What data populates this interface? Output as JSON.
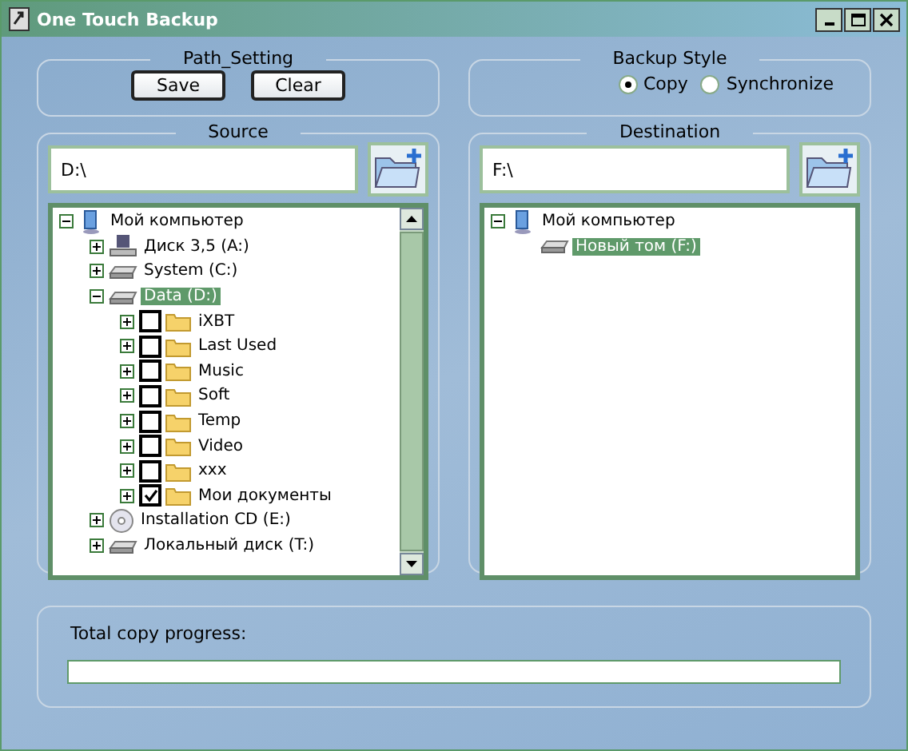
{
  "window": {
    "title": "One Touch Backup"
  },
  "path_setting": {
    "title": "Path_Setting",
    "buttons": [
      "Save",
      "Clear"
    ]
  },
  "backup_style": {
    "title": "Backup Style",
    "options": [
      {
        "label": "Copy",
        "selected": true
      },
      {
        "label": "Synchronize",
        "selected": false
      }
    ]
  },
  "source": {
    "title": "Source",
    "path": "D:\\",
    "tree": [
      {
        "kind": "computer",
        "label": "Мой компьютер",
        "expanded": true,
        "selected": false,
        "children": [
          {
            "kind": "floppy",
            "label": "Диск 3,5 (A:)",
            "expanded": false,
            "selected": false
          },
          {
            "kind": "drive",
            "label": "System (C:)",
            "expanded": false,
            "selected": false
          },
          {
            "kind": "drive",
            "label": "Data (D:)",
            "expanded": true,
            "selected": true,
            "children": [
              {
                "kind": "folder",
                "label": "iXBT",
                "expanded": false,
                "selected": false,
                "checked": false
              },
              {
                "kind": "folder",
                "label": "Last Used",
                "expanded": false,
                "selected": false,
                "checked": false
              },
              {
                "kind": "folder",
                "label": "Music",
                "expanded": false,
                "selected": false,
                "checked": false
              },
              {
                "kind": "folder",
                "label": "Soft",
                "expanded": false,
                "selected": false,
                "checked": false
              },
              {
                "kind": "folder",
                "label": "Temp",
                "expanded": false,
                "selected": false,
                "checked": false
              },
              {
                "kind": "folder",
                "label": "Video",
                "expanded": false,
                "selected": false,
                "checked": false
              },
              {
                "kind": "folder",
                "label": "xxx",
                "expanded": false,
                "selected": false,
                "checked": false
              },
              {
                "kind": "folder",
                "label": "Мои документы",
                "expanded": false,
                "selected": false,
                "checked": true
              }
            ]
          },
          {
            "kind": "cd",
            "label": "Installation CD (E:)",
            "expanded": false,
            "selected": false
          },
          {
            "kind": "drive",
            "label": "Локальный диск (T:)",
            "expanded": false,
            "selected": false
          }
        ]
      }
    ]
  },
  "destination": {
    "title": "Destination",
    "path": "F:\\",
    "tree": [
      {
        "kind": "computer",
        "label": "Мой компьютер",
        "expanded": true,
        "selected": false,
        "children": [
          {
            "kind": "drive",
            "label": "Новый том (F:)",
            "selected": true
          }
        ]
      }
    ]
  },
  "progress": {
    "label": "Total copy progress:",
    "level": 0
  }
}
